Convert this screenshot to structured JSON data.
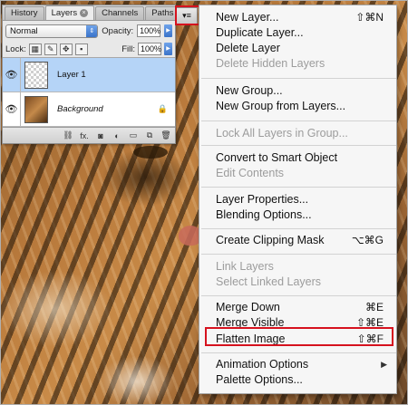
{
  "palette": {
    "tabs": [
      {
        "label": "History"
      },
      {
        "label": "Layers"
      },
      {
        "label": "Channels"
      },
      {
        "label": "Paths"
      }
    ],
    "blend_mode": "Normal",
    "opacity_label": "Opacity:",
    "opacity_value": "100%",
    "lock_label": "Lock:",
    "fill_label": "Fill:",
    "fill_value": "100%",
    "layers": [
      {
        "name": "Layer 1",
        "selected": true
      },
      {
        "name": "Background",
        "selected": false
      }
    ],
    "bottom_icons": [
      "link-icon",
      "fx-icon",
      "mask-icon",
      "adjustment-icon",
      "folder-icon",
      "new-layer-icon",
      "trash-icon"
    ],
    "bottom_fx_label": "fx."
  },
  "menu_button_glyph": "▾≡",
  "menu": {
    "items": [
      {
        "label": "New Layer...",
        "shortcut": "⇧⌘N",
        "enabled": true
      },
      {
        "label": "Duplicate Layer...",
        "shortcut": "",
        "enabled": true
      },
      {
        "label": "Delete Layer",
        "shortcut": "",
        "enabled": true
      },
      {
        "label": "Delete Hidden Layers",
        "shortcut": "",
        "enabled": false
      },
      {
        "label": "New Group...",
        "shortcut": "",
        "enabled": true
      },
      {
        "label": "New Group from Layers...",
        "shortcut": "",
        "enabled": true
      },
      {
        "label": "Lock All Layers in Group...",
        "shortcut": "",
        "enabled": false
      },
      {
        "label": "Convert to Smart Object",
        "shortcut": "",
        "enabled": true
      },
      {
        "label": "Edit Contents",
        "shortcut": "",
        "enabled": false
      },
      {
        "label": "Layer Properties...",
        "shortcut": "",
        "enabled": true
      },
      {
        "label": "Blending Options...",
        "shortcut": "",
        "enabled": true
      },
      {
        "label": "Create Clipping Mask",
        "shortcut": "⌥⌘G",
        "enabled": true
      },
      {
        "label": "Link Layers",
        "shortcut": "",
        "enabled": false
      },
      {
        "label": "Select Linked Layers",
        "shortcut": "",
        "enabled": false
      },
      {
        "label": "Merge Down",
        "shortcut": "⌘E",
        "enabled": true
      },
      {
        "label": "Merge Visible",
        "shortcut": "⇧⌘E",
        "enabled": true
      },
      {
        "label": "Flatten Image",
        "shortcut": "⇧⌘F",
        "enabled": true,
        "highlighted": true
      },
      {
        "label": "Animation Options",
        "shortcut": "",
        "enabled": true,
        "submenu": true
      },
      {
        "label": "Palette Options...",
        "shortcut": "",
        "enabled": true
      }
    ]
  },
  "colors": {
    "highlight_red": "#d6121e",
    "selected_layer": "#b5d4f7",
    "disabled_text": "#9c9c9c"
  }
}
